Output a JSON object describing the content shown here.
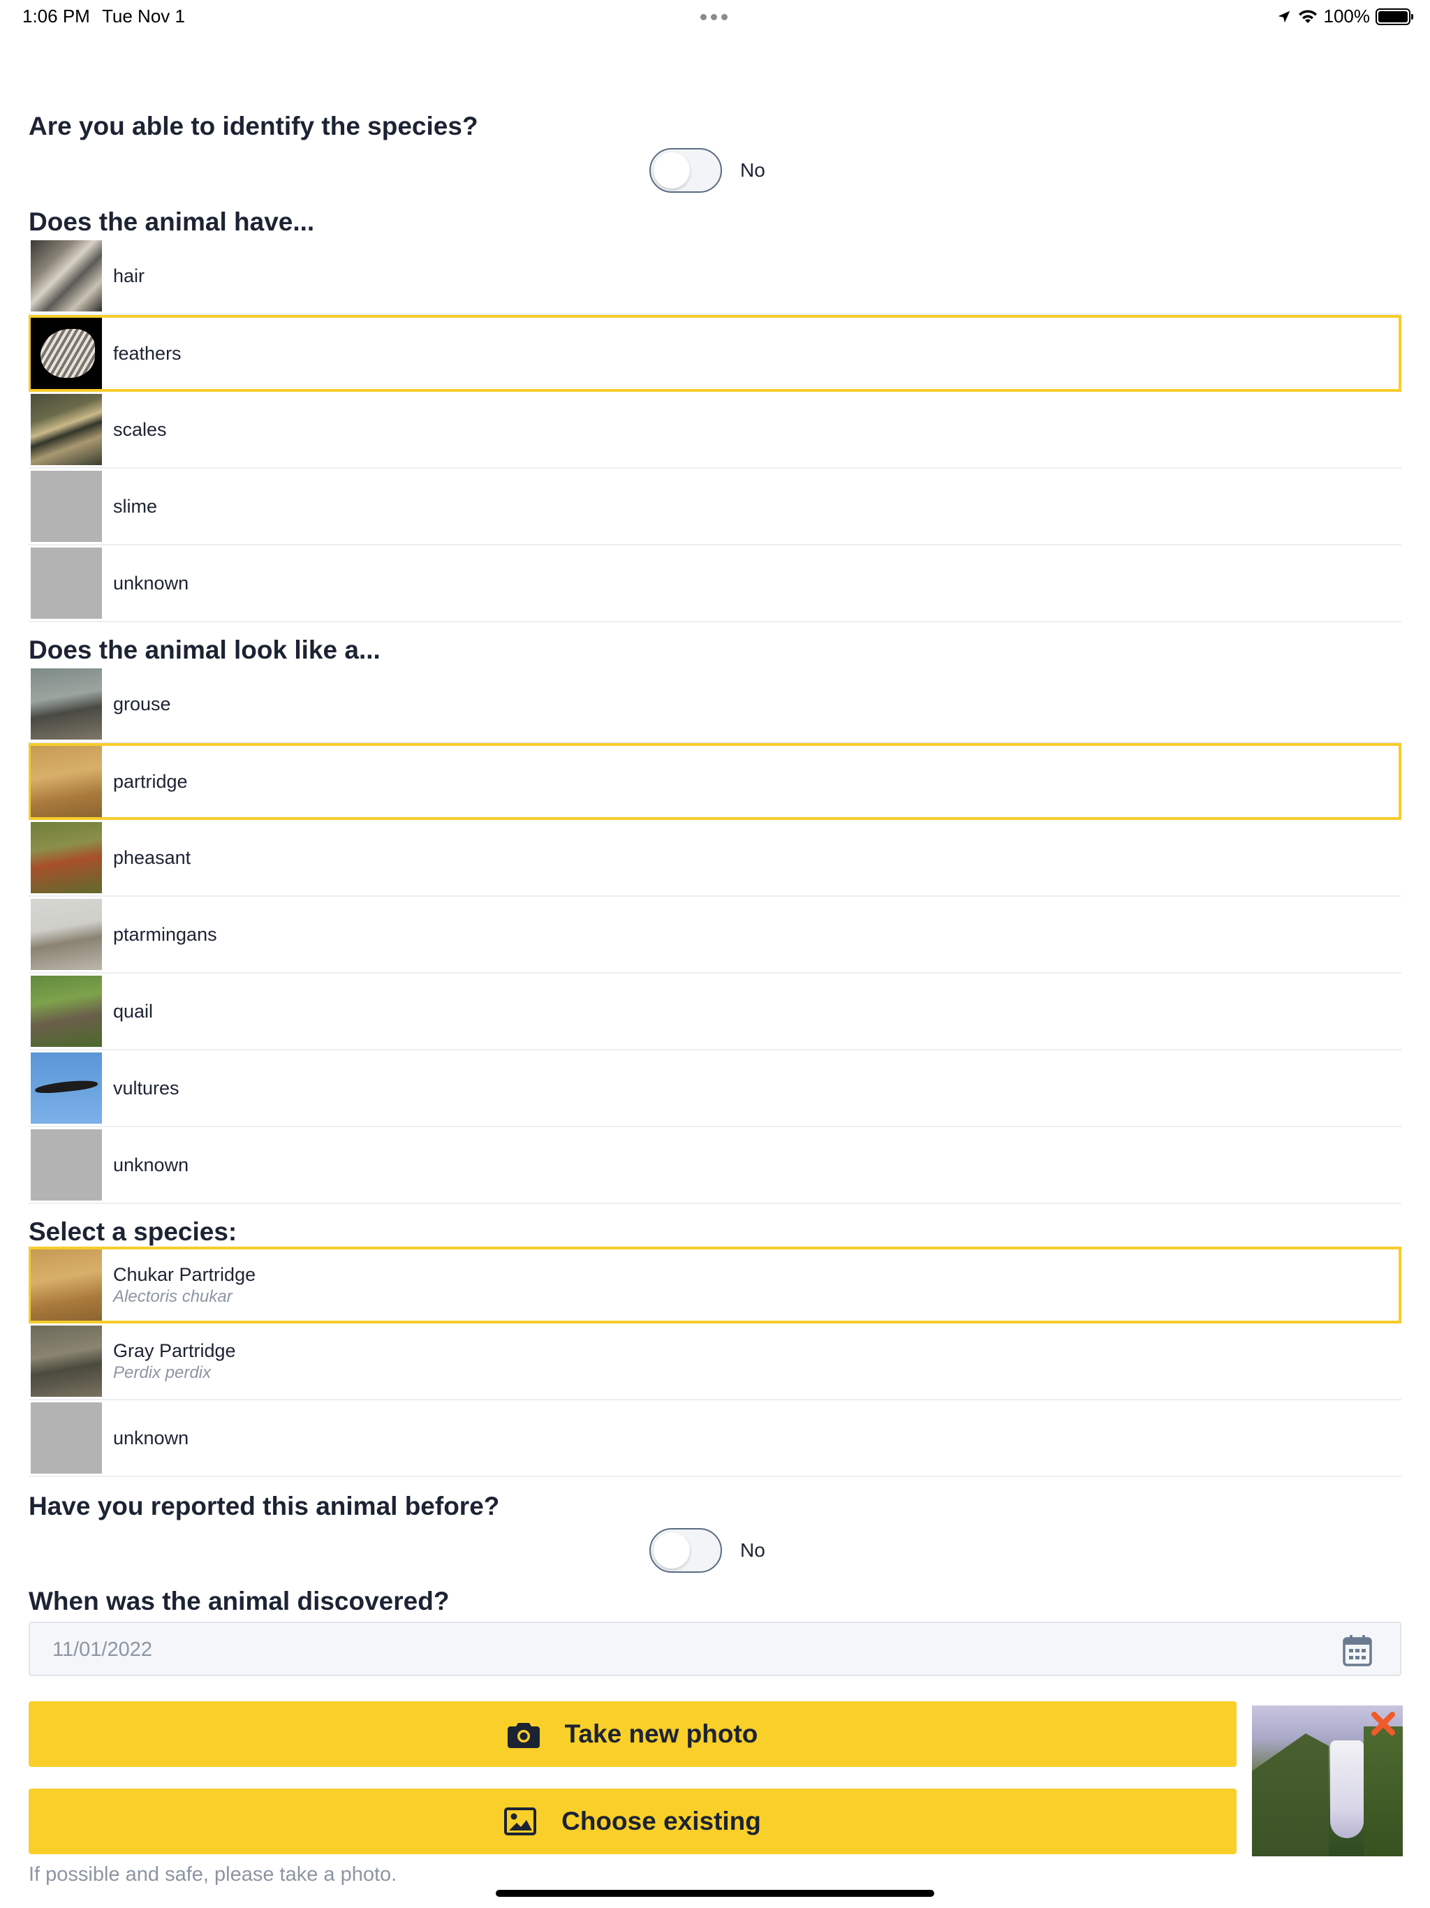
{
  "status_bar": {
    "time": "1:06 PM",
    "date": "Tue Nov 1",
    "battery": "100%"
  },
  "identify": {
    "question": "Are you able to identify the species?",
    "toggle_value": "No",
    "toggle_on": false
  },
  "features": {
    "heading": "Does the animal have...",
    "items": [
      {
        "label": "hair",
        "selected": false
      },
      {
        "label": "feathers",
        "selected": true
      },
      {
        "label": "scales",
        "selected": false
      },
      {
        "label": "slime",
        "selected": false
      },
      {
        "label": "unknown",
        "selected": false
      }
    ]
  },
  "look_like": {
    "heading": "Does the animal look like a...",
    "items": [
      {
        "label": "grouse",
        "selected": false
      },
      {
        "label": "partridge",
        "selected": true
      },
      {
        "label": "pheasant",
        "selected": false
      },
      {
        "label": "ptarmingans",
        "selected": false
      },
      {
        "label": "quail",
        "selected": false
      },
      {
        "label": "vultures",
        "selected": false
      },
      {
        "label": "unknown",
        "selected": false
      }
    ]
  },
  "species": {
    "heading": "Select a species:",
    "items": [
      {
        "label": "Chukar Partridge",
        "scientific": "Alectoris chukar",
        "selected": true
      },
      {
        "label": "Gray Partridge",
        "scientific": "Perdix perdix",
        "selected": false
      },
      {
        "label": "unknown",
        "selected": false
      }
    ]
  },
  "reported": {
    "question": "Have you reported this animal before?",
    "toggle_value": "No",
    "toggle_on": false
  },
  "discovered": {
    "question": "When was the animal discovered?",
    "date_value": "11/01/2022",
    "icon": "calendar-icon"
  },
  "photo": {
    "take_label": "Take new photo",
    "take_icon": "camera-icon",
    "choose_label": "Choose existing",
    "choose_icon": "image-icon",
    "hint": "If possible and safe, please take a photo.",
    "remove_icon": "close-icon"
  },
  "colors": {
    "accent": "#f9cf2a",
    "selected_border": "#f7cc2b",
    "text": "#1c2333",
    "muted": "#8c95a3",
    "remove": "#f05a2a"
  }
}
